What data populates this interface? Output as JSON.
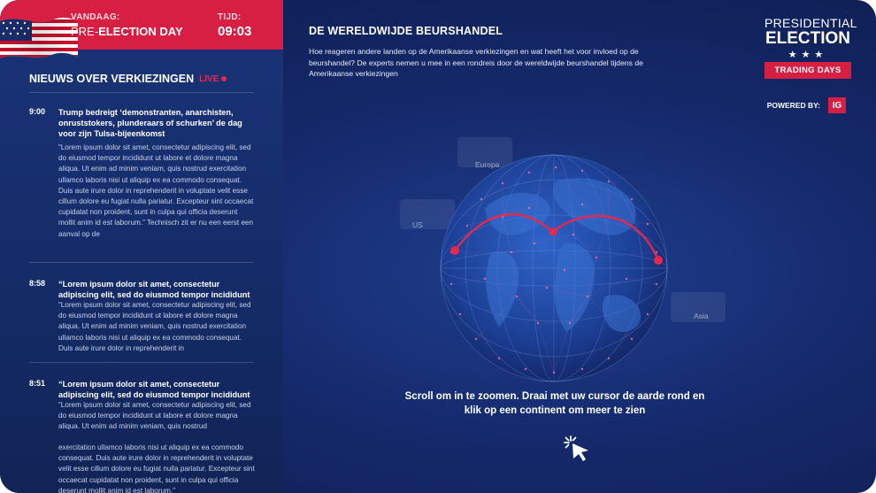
{
  "topbar": {
    "date_label": "VANDAAG:",
    "date_value_prefix": "PRE-",
    "date_value_bold": "ELECTION DAY",
    "time_label": "TIJD:",
    "time_value": "09:03"
  },
  "news": {
    "heading": "NIEUWS OVER VERKIEZINGEN",
    "live_label": "LIVE",
    "items": [
      {
        "time": "9:00",
        "title": "Trump bedreigt ‘demonstranten, anarchisten, onruststokers, plunderaars of schurken’ de dag voor zijn Tulsa-bijeenkomst",
        "body": "“Lorem ipsum dolor sit amet, consectetur adipiscing elit, sed do eiusmod tempor incididunt ut labore et dolore magna aliqua. Ut enim ad minim veniam, quis nostrud exercitation ullamco laboris nisi ut aliquip ex ea commodo consequat. Duis aute irure dolor in reprehenderit in voluptate velit esse cillum dolore eu fugiat nulla pariatur. Excepteur sint occaecat cupidatat non proident, sunt in culpa qui officia deserunt mollit anim id est laborum.” Technisch zit er nu een eerst een aanval op de"
      },
      {
        "time": "8:58",
        "title": "“Lorem ipsum dolor sit amet, consectetur adipiscing elit, sed do eiusmod tempor incididunt",
        "body": "“Lorem ipsum dolor sit amet, consectetur adipiscing elit, sed do eiusmod tempor incididunt ut labore et dolore magna aliqua. Ut enim ad minim veniam, quis nostrud exercitation ullamco laboris nisi ut aliquip ex ea commodo consequat. Duis aute irure dolor in reprehenderit in"
      },
      {
        "time": "8:51",
        "title": "“Lorem ipsum dolor sit amet, consectetur adipiscing elit, sed do eiusmod tempor incididunt",
        "body": "“Lorem ipsum dolor sit amet, consectetur adipiscing elit, sed do eiusmod tempor incididunt ut labore et dolore magna aliqua. Ut enim ad minim veniam, quis nostrud",
        "body2": "exercitation ullamco laboris nisi ut aliquip ex ea commodo consequat. Duis aute irure dolor in reprehenderit in voluptate velit esse cillum dolore eu fugiat nulla pariatur. Excepteur sint occaecat cupidatat non proident, sunt in culpa qui officia deserunt mollit anim id est laborum.”"
      }
    ]
  },
  "main": {
    "title": "DE WERELDWIJDE BEURSHANDEL",
    "description": "Hoe reageren andere landen op de Amerikaanse verkiezingen en wat heeft het voor invloed op de beurshandel? De experts nemen u mee in een rondreis door de wereldwijde beurshandel tijdens de Amerikaanse verkiezingen",
    "regions": [
      "Europa",
      "US",
      "Asia"
    ],
    "instructions": "Scroll om in te zoomen. Draai met uw cursor de aarde rond en klik op een continent om meer te zien"
  },
  "logo": {
    "line1": "PRESIDENTIAL",
    "line2": "ELECTION",
    "stars": "★★★",
    "line3": "TRADING DAYS",
    "powered_by": "POWERED BY:",
    "ig": "IG"
  },
  "colors": {
    "accent_red": "#d61f43",
    "background_navy": "#15296b"
  },
  "icons": [
    "us-flag-icon",
    "live-dot-icon",
    "globe-icon",
    "click-cursor-icon"
  ]
}
